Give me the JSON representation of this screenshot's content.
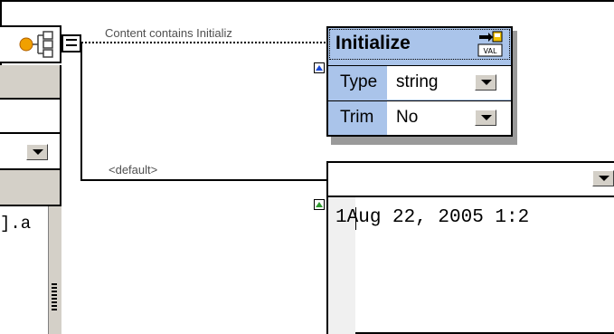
{
  "left_component": {
    "list_text": "].a",
    "icon": "hierarchy-icon"
  },
  "connector": {
    "condition_label": "Content contains Initializ",
    "default_label": "<default>"
  },
  "initialize_popup": {
    "title": "Initialize",
    "badge_text": "VAL",
    "properties": [
      {
        "label": "Type",
        "value": "string"
      },
      {
        "label": "Trim",
        "value": "No"
      }
    ]
  },
  "default_editor": {
    "line_number": "1",
    "content": "Aug 22, 2005 1:2"
  },
  "colors": {
    "popup_background": "#aac4ea",
    "panel_grey": "#d4d0c8",
    "marker_blue": "#1a4ad8",
    "marker_green": "#2e9a2e"
  }
}
